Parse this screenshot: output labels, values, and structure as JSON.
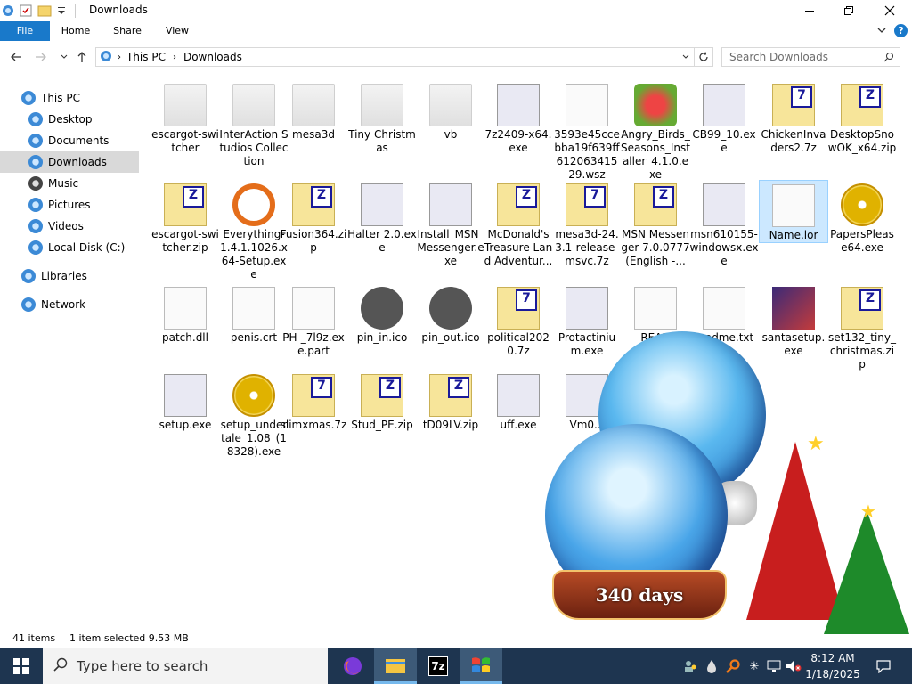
{
  "window": {
    "title": "Downloads",
    "minimize_icon": "minimize-icon",
    "maximize_icon": "maximize-icon",
    "close_icon": "close-icon"
  },
  "ribbon": {
    "tabs": [
      "File",
      "Home",
      "Share",
      "View"
    ]
  },
  "address": {
    "path": [
      "This PC",
      "Downloads"
    ],
    "search_placeholder": "Search Downloads"
  },
  "sidebar": {
    "items": [
      {
        "label": "This PC",
        "icon": "computer-icon"
      },
      {
        "label": "Desktop",
        "icon": "desktop-icon"
      },
      {
        "label": "Documents",
        "icon": "documents-icon"
      },
      {
        "label": "Downloads",
        "icon": "downloads-icon",
        "selected": true
      },
      {
        "label": "Music",
        "icon": "music-icon"
      },
      {
        "label": "Pictures",
        "icon": "pictures-icon"
      },
      {
        "label": "Videos",
        "icon": "videos-icon"
      },
      {
        "label": "Local Disk (C:)",
        "icon": "disk-icon"
      },
      {
        "label": "Libraries",
        "icon": "libraries-icon"
      },
      {
        "label": "Network",
        "icon": "network-icon"
      }
    ]
  },
  "files": [
    {
      "name": "escargot-switcher",
      "type": "folder"
    },
    {
      "name": "InterAction Studios Collection",
      "type": "folder"
    },
    {
      "name": "mesa3d",
      "type": "folder"
    },
    {
      "name": "Tiny Christmas",
      "type": "folder"
    },
    {
      "name": "vb",
      "type": "folder"
    },
    {
      "name": "7z2409-x64.exe",
      "type": "exe"
    },
    {
      "name": "3593e45ccebba19f639ff612063415 29.wsz",
      "type": "doc"
    },
    {
      "name": "Angry_Birds_Seasons_Installer_4.1.0.exe",
      "type": "bird"
    },
    {
      "name": "CB99_10.exe",
      "type": "exe"
    },
    {
      "name": "ChickenInvaders2.7z",
      "type": "7z"
    },
    {
      "name": "DesktopSnowOK_x64.zip",
      "type": "zip"
    },
    {
      "name": "escargot-switcher.zip",
      "type": "zip"
    },
    {
      "name": "Everything-1.4.1.1026.x64-Setup.exe",
      "type": "key"
    },
    {
      "name": "Fusion364.zip",
      "type": "zip"
    },
    {
      "name": "Halter 2.0.exe",
      "type": "exe"
    },
    {
      "name": "Install_MSN_Messenger.exe",
      "type": "exe"
    },
    {
      "name": "McDonald's Treasure Land Adventur...",
      "type": "zip"
    },
    {
      "name": "mesa3d-24.3.1-release-msvc.7z",
      "type": "7z"
    },
    {
      "name": "MSN Messenger 7.0.0777 (English -...",
      "type": "zip"
    },
    {
      "name": "msn610155-windowsx.exe",
      "type": "exe"
    },
    {
      "name": "Name.lor",
      "type": "doc",
      "selected": true
    },
    {
      "name": "PapersPlease64.exe",
      "type": "disc"
    },
    {
      "name": "patch.dll",
      "type": "doc"
    },
    {
      "name": "penis.crt",
      "type": "doc"
    },
    {
      "name": "PH-_7l9z.exe.part",
      "type": "doc"
    },
    {
      "name": "pin_in.ico",
      "type": "dark"
    },
    {
      "name": "pin_out.ico",
      "type": "dark"
    },
    {
      "name": "political2020.7z",
      "type": "7z"
    },
    {
      "name": "Protactinium.exe",
      "type": "exe"
    },
    {
      "name": "READ",
      "type": "doc"
    },
    {
      "name": "readme.txt",
      "type": "doc"
    },
    {
      "name": "santasetup.exe",
      "type": "santa"
    },
    {
      "name": "set132_tiny_christmas.zip",
      "type": "zip"
    },
    {
      "name": "setup.exe",
      "type": "exe"
    },
    {
      "name": "setup_undertale_1.08_(18328).exe",
      "type": "disc"
    },
    {
      "name": "slimxmas.7z",
      "type": "7z"
    },
    {
      "name": "Stud_PE.zip",
      "type": "zip"
    },
    {
      "name": "tD09LV.zip",
      "type": "zip"
    },
    {
      "name": "uff.exe",
      "type": "exe"
    },
    {
      "name": "Vm0...",
      "type": "exe"
    }
  ],
  "overlay": {
    "globe_caption": "340 days"
  },
  "status": {
    "item_count": "41 items",
    "selection": "1 item selected  9.53 MB"
  },
  "taskbar": {
    "search_placeholder": "Type here to search",
    "time": "8:12 AM",
    "date": "1/18/2025",
    "apps": [
      "firefox-icon",
      "file-explorer-icon",
      "7zip-icon",
      "windows-xp-icon"
    ]
  }
}
